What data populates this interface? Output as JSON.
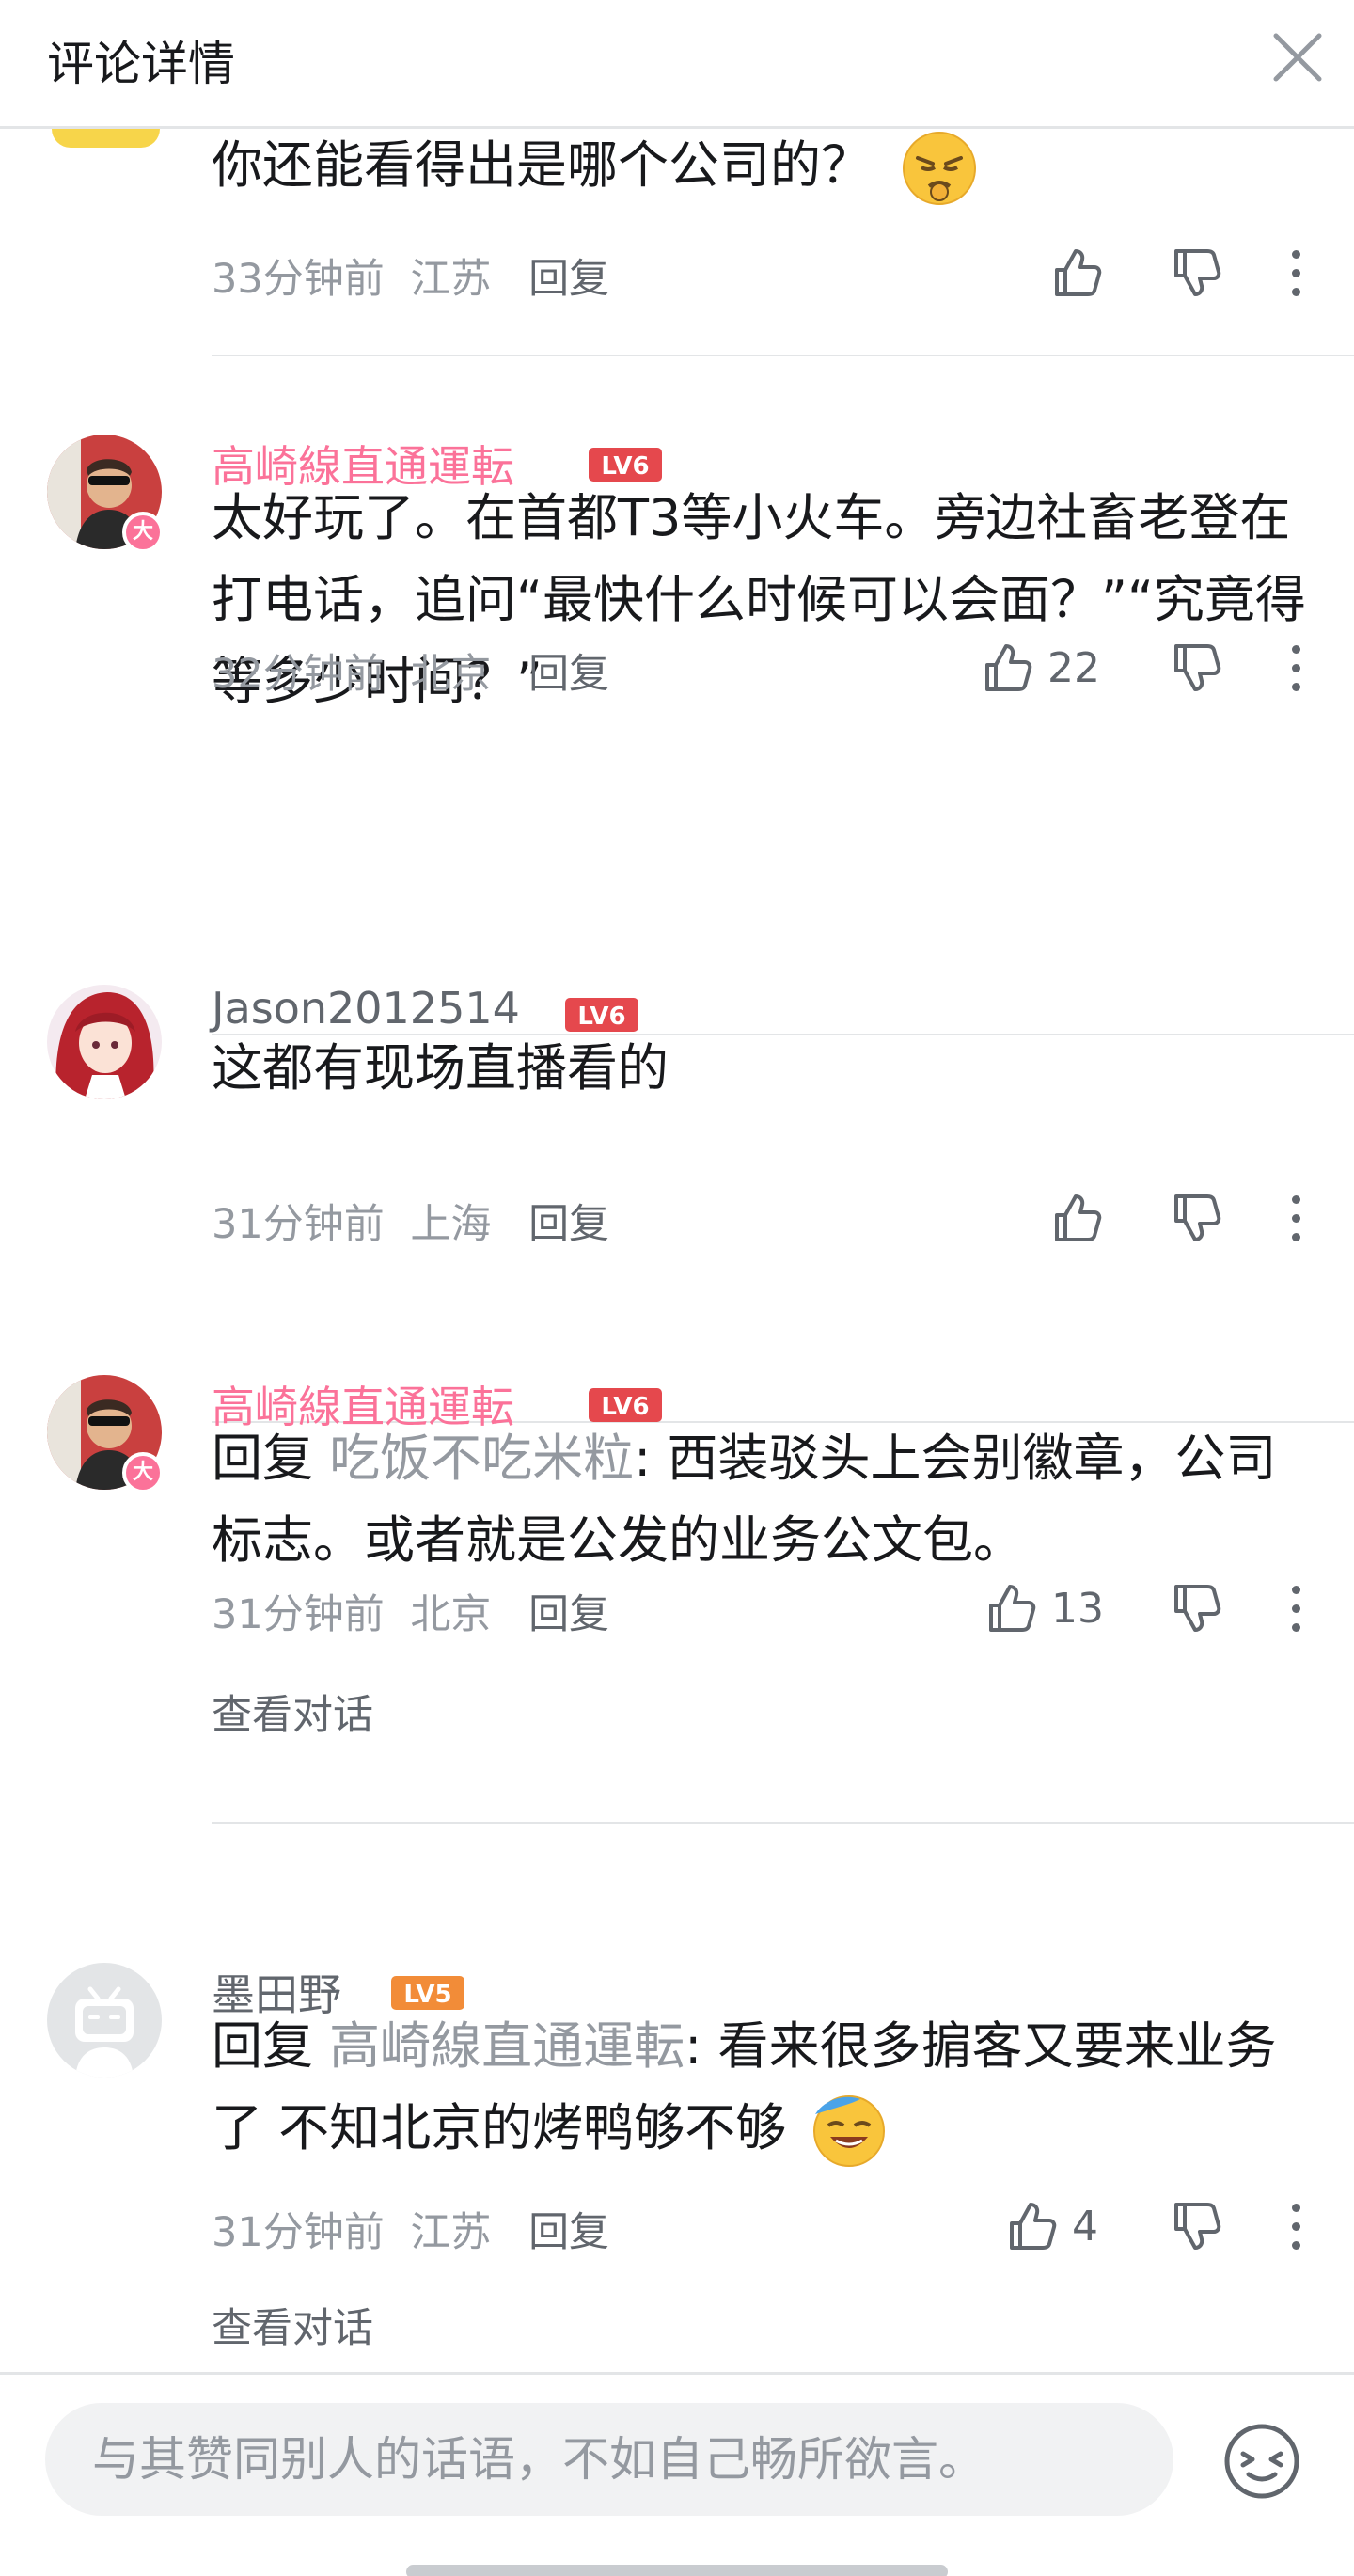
{
  "header": {
    "title": "评论详情"
  },
  "comments": [
    {
      "content": "你还能看得出是哪个公司的？",
      "time": "33分钟前",
      "location": "江苏",
      "reply_label": "回复",
      "likes": ""
    },
    {
      "name": "高崎線直通運転",
      "level": "LV6",
      "badge": "大",
      "content": "太好玩了。在首都T3等小火车。旁边社畜老登在打电话，追问“最快什么时候可以会面？”“究竟得等多少时间？”",
      "time": "32分钟前",
      "location": "北京",
      "reply_label": "回复",
      "likes": "22"
    },
    {
      "name": "Jason2012514",
      "level": "LV6",
      "content": "这都有现场直播看的",
      "time": "31分钟前",
      "location": "上海",
      "reply_label": "回复",
      "likes": ""
    },
    {
      "name": "高崎線直通運転",
      "level": "LV6",
      "badge": "大",
      "reply_prefix": "回复 ",
      "reply_to": "吃饭不吃米粒",
      "content": ": 西装驳头上会别徽章，公司标志。或者就是公发的业务公文包。",
      "time": "31分钟前",
      "location": "北京",
      "reply_label": "回复",
      "likes": "13",
      "view_conversation": "查看对话"
    },
    {
      "name": "墨田野",
      "level": "LV5",
      "reply_prefix": "回复 ",
      "reply_to": "高崎線直通運転",
      "content": ": 看来很多掮客又要来业务了  不知北京的烤鸭够不够",
      "time": "31分钟前",
      "location": "江苏",
      "reply_label": "回复",
      "likes": "4",
      "view_conversation": "查看对话"
    }
  ],
  "input": {
    "placeholder": "与其赞同别人的话语，不如自己畅所欲言。"
  },
  "colors": {
    "vip_name": "#fb7299",
    "level6": "#e5484d",
    "level5": "#f28c38",
    "meta": "#9499a0"
  }
}
